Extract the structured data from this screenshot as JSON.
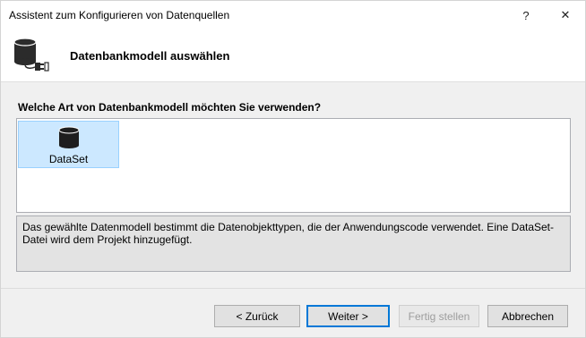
{
  "window": {
    "title": "Assistent zum Konfigurieren von Datenquellen",
    "help_label": "?",
    "close_label": "✕"
  },
  "header": {
    "icon": "database-connect-icon",
    "title": "Datenbankmodell auswählen"
  },
  "content": {
    "question": "Welche Art von Datenbankmodell möchten Sie verwenden?",
    "models": [
      {
        "label": "DataSet",
        "icon": "database-icon",
        "selected": true
      }
    ],
    "description": "Das gewählte Datenmodell bestimmt die Datenobjekttypen, die der Anwendungscode verwendet. Eine DataSet-Datei wird dem Projekt hinzugefügt."
  },
  "buttons": {
    "back": "< Zurück",
    "next": "Weiter >",
    "finish": "Fertig stellen",
    "cancel": "Abbrechen"
  },
  "colors": {
    "selection_fill": "#cce8ff",
    "selection_border": "#99d1ff",
    "default_button_border": "#0078d7",
    "description_background": "#e3e3e3"
  }
}
